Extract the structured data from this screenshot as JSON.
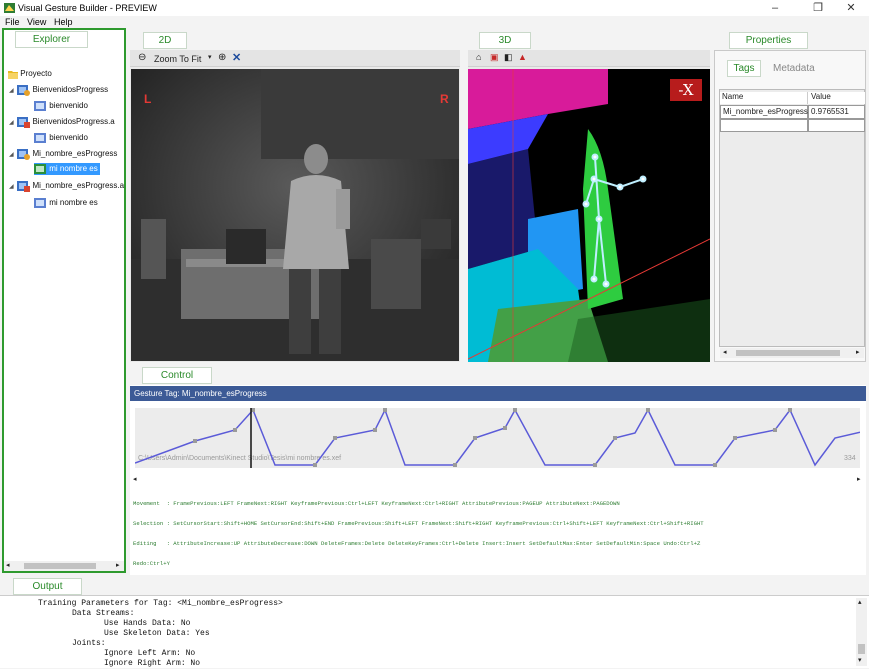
{
  "titlebar": {
    "title": "Visual Gesture Builder - PREVIEW",
    "minimize": "–",
    "restore": "❐",
    "close": "✕"
  },
  "menu": {
    "items": [
      "File",
      "View",
      "Help"
    ]
  },
  "explorer": {
    "tab_label": "Explorer",
    "tree": [
      {
        "label": "Proyecto",
        "icon": "folder-icon"
      },
      {
        "label": "BienvenidosProgress",
        "icon": "gesture-project-icon"
      },
      {
        "label": "bienvenido",
        "icon": "gesture-clip-icon"
      },
      {
        "label": "BienvenidosProgress.a",
        "icon": "gesture-analysis-icon"
      },
      {
        "label": "bienvenido",
        "icon": "gesture-clip-icon"
      },
      {
        "label": "Mi_nombre_esProgress",
        "icon": "gesture-project-icon"
      },
      {
        "label": "mi nombre es",
        "icon": "gesture-clip-icon",
        "selected": true
      },
      {
        "label": "Mi_nombre_esProgress.a",
        "icon": "gesture-analysis-icon"
      },
      {
        "label": "mi nombre es",
        "icon": "gesture-clip-icon"
      }
    ]
  },
  "view2d": {
    "tab_label": "2D",
    "zoom": "Zoom To Fit",
    "left_marker": "L",
    "right_marker": "R"
  },
  "view3d": {
    "tab_label": "3D",
    "axis_label": "-X"
  },
  "properties": {
    "tab_label": "Properties",
    "subtabs": [
      "Tags",
      "Metadata"
    ],
    "columns": [
      "Name",
      "Value"
    ],
    "rows": [
      {
        "name": "Mi_nombre_esProgress",
        "value": "0.9765531"
      }
    ]
  },
  "control": {
    "tab_label": "Control",
    "gesture_tag": "Gesture Tag: Mi_nombre_esProgress",
    "file_path": "C:\\Users\\Admin\\Documents\\Kinect Studio\\Tesis\\mi nombre es.xef",
    "frame_count": "334",
    "shortcuts": [
      "Movement  : FramePrevious:LEFT FrameNext:RIGHT KeyframePrevious:Ctrl+LEFT KeyframeNext:Ctrl+RIGHT AttributePrevious:PAGEUP AttributeNext:PAGEDOWN",
      "Selection : SetCursorStart:Shift+HOME SetCursorEnd:Shift+END FramePrevious:Shift+LEFT FrameNext:Shift+RIGHT KeyframePrevious:Ctrl+Shift+LEFT KeyframeNext:Ctrl+Shift+RIGHT",
      "Editing   : AttributeIncrease:UP AttributeDecrease:DOWN DeleteFrames:Delete DeleteKeyFrames:Ctrl+Delete Insert:Insert SetDefaultMax:Enter SetDefaultMin:Space Undo:Ctrl+Z",
      "Redo:Ctrl+Y"
    ],
    "signal_color": "#5b5bd8"
  },
  "output": {
    "tab_label": "Output",
    "lines": [
      "Training Parameters for Tag: <Mi_nombre_esProgress>",
      "Data Streams:",
      "Use Hands Data: No",
      "Use Skeleton Data: Yes",
      "Joints:",
      "Ignore Left Arm: No",
      "Ignore Right Arm: No"
    ]
  },
  "colors": {
    "accent_green": "#2e9a2e",
    "selection_blue": "#3399ff",
    "header_blue": "#3c5a96"
  }
}
